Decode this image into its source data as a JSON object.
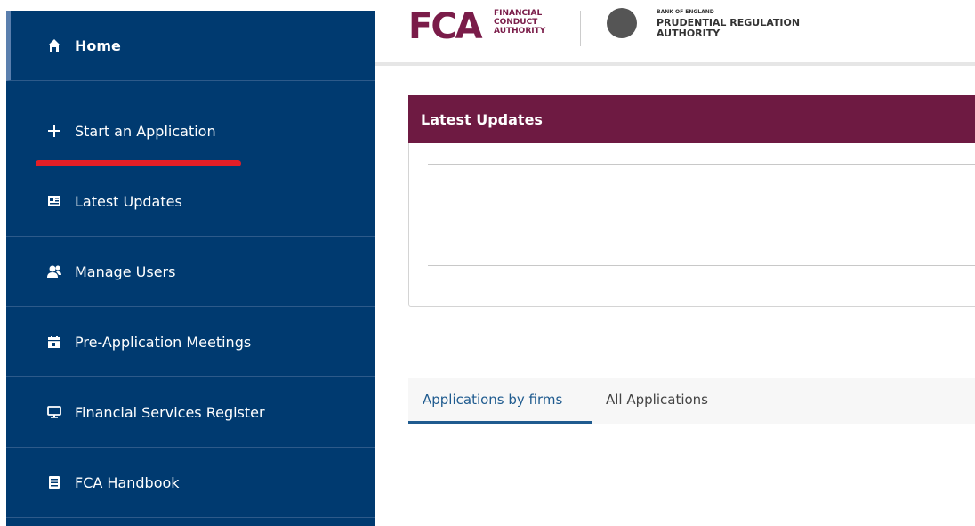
{
  "sidebar": {
    "items": [
      {
        "label": "Home",
        "icon": "home-icon"
      },
      {
        "label": "Start an Application",
        "icon": "plus-icon"
      },
      {
        "label": "Latest Updates",
        "icon": "newspaper-icon"
      },
      {
        "label": "Manage Users",
        "icon": "users-icon"
      },
      {
        "label": "Pre-Application Meetings",
        "icon": "calendar-icon"
      },
      {
        "label": "Financial Services Register",
        "icon": "monitor-icon"
      },
      {
        "label": "FCA Handbook",
        "icon": "book-icon"
      }
    ]
  },
  "header": {
    "fca_logo": "FCA",
    "fca_line1": "FINANCIAL",
    "fca_line2": "CONDUCT",
    "fca_line3": "AUTHORITY",
    "boe_top": "BANK OF ENGLAND",
    "boe_line1": "PRUDENTIAL REGULATION",
    "boe_line2": "AUTHORITY"
  },
  "updates": {
    "title": "Latest Updates"
  },
  "tabs": [
    {
      "label": "Applications by firms",
      "active": true
    },
    {
      "label": "All Applications",
      "active": false
    }
  ],
  "colors": {
    "sidebar_bg": "#003a70",
    "brand_maroon": "#6e1a42",
    "tab_active": "#1f5b8f",
    "highlight_red": "#e41e26"
  }
}
